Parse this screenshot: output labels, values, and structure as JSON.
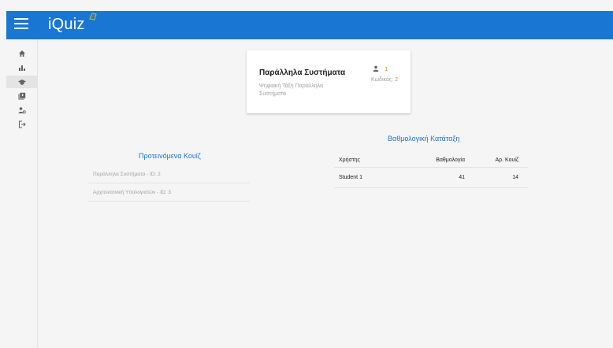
{
  "app": {
    "title": "iQuiz"
  },
  "sidebar": {
    "items": [
      {
        "icon": "home-icon",
        "active": false
      },
      {
        "icon": "bar-chart-icon",
        "active": false
      },
      {
        "icon": "graduation-cap-icon",
        "active": true
      },
      {
        "icon": "quiz-library-icon",
        "active": false
      },
      {
        "icon": "account-settings-icon",
        "active": false
      },
      {
        "icon": "logout-icon",
        "active": false
      }
    ]
  },
  "card": {
    "title": "Παράλληλα Συστήματα",
    "subtitle": "Ψηφιακή Τάξη Παράλληλα Συστήματα",
    "members": "1",
    "code_label": "Κωδικός:",
    "code_value": "2"
  },
  "recommended": {
    "title": "Προτεινόμενα Κουίζ",
    "items": [
      "Παράλληλα Συστήματα - ID: 2",
      "Αρχιτεκτονική Υπολογιστών - ID: 3"
    ]
  },
  "ranking": {
    "title": "Βαθμολογική Κατάταξη",
    "headers": [
      "Χρήστης",
      "Βαθμολογία",
      "Αρ. Κουίζ"
    ],
    "rows": [
      [
        "Student 1",
        "41",
        "14"
      ]
    ]
  },
  "colors": {
    "primary": "#1976d2",
    "accent": "#f57c00"
  }
}
